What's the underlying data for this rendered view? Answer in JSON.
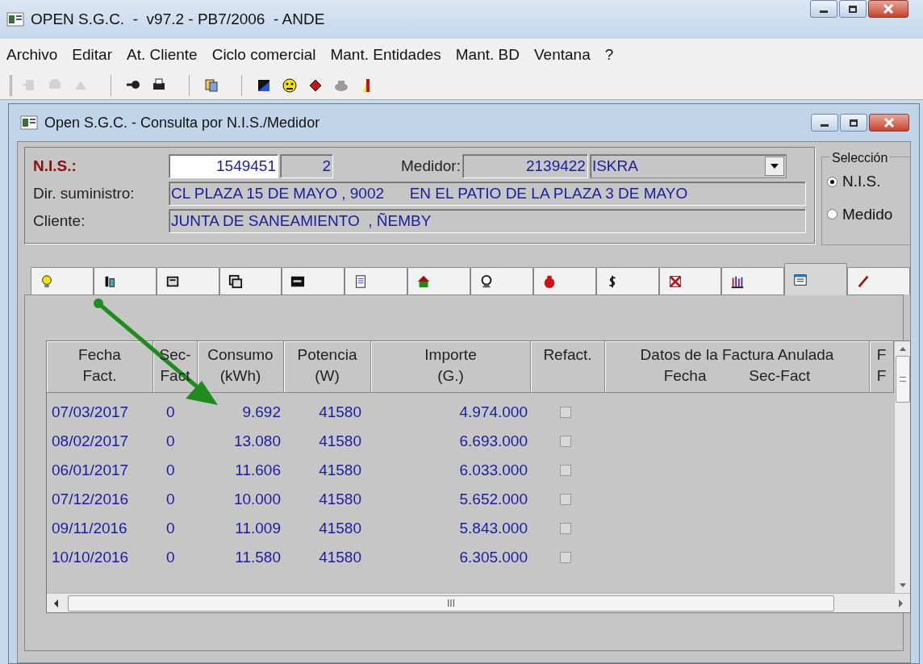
{
  "window": {
    "title": "OPEN S.G.C.  -  v97.2 - PB7/2006  - ANDE"
  },
  "menu": [
    "Archivo",
    "Editar",
    "At. Cliente",
    "Ciclo comercial",
    "Mant. Entidades",
    "Mant. BD",
    "Ventana",
    "?"
  ],
  "toolbar": [
    {
      "disabled": true
    },
    {
      "disabled": true
    },
    {
      "disabled": true
    },
    {
      "disabled": false
    },
    {
      "disabled": false
    },
    {
      "disabled": false
    },
    {
      "disabled": false
    },
    {
      "disabled": false
    },
    {
      "disabled": false
    },
    {
      "disabled": false
    },
    {
      "disabled": false
    }
  ],
  "child_window": {
    "title": "Open S.G.C. - Consulta por N.I.S./Medidor"
  },
  "form": {
    "nis_label": "N.I.S.:",
    "nis": "1549451",
    "nis_seq": "2",
    "medidor_label": "Medidor:",
    "medidor": "2139422",
    "medidor_brand": "ISKRA",
    "dir_label": "Dir. suministro:",
    "dir": "CL PLAZA 15 DE MAYO , 9002      EN EL PATIO DE LA PLAZA 3 DE MAYO",
    "cliente_label": "Cliente:",
    "cliente": "JUNTA DE SANEAMIENTO  , ÑEMBY"
  },
  "seleccion": {
    "title": "Selección",
    "options": [
      {
        "label": "N.I.S.",
        "selected": true
      },
      {
        "label": "Medido",
        "selected": false
      }
    ]
  },
  "tabs": [
    {
      "selected": false
    },
    {
      "selected": false
    },
    {
      "selected": false
    },
    {
      "selected": false
    },
    {
      "selected": false
    },
    {
      "selected": false
    },
    {
      "selected": false
    },
    {
      "selected": false
    },
    {
      "selected": false
    },
    {
      "selected": false
    },
    {
      "selected": false
    },
    {
      "selected": false
    },
    {
      "selected": true
    },
    {
      "selected": false
    }
  ],
  "table": {
    "columns": [
      [
        "Fecha",
        "Fact."
      ],
      [
        "Sec-",
        "Fact"
      ],
      [
        "Consumo",
        "(kWh)"
      ],
      [
        "Potencia",
        "(W)"
      ],
      [
        "Importe",
        "(G.)"
      ],
      [
        "Refact."
      ],
      [
        "Datos de la Factura Anulada",
        "Fecha          Sec-Fact"
      ],
      [
        "F",
        "F"
      ]
    ],
    "rows": [
      {
        "fecha": "07/03/2017",
        "sec": "0",
        "consumo": "9.692",
        "potencia": "41580",
        "importe": "4.974.000",
        "refact": false
      },
      {
        "fecha": "08/02/2017",
        "sec": "0",
        "consumo": "13.080",
        "potencia": "41580",
        "importe": "6.693.000",
        "refact": false
      },
      {
        "fecha": "06/01/2017",
        "sec": "0",
        "consumo": "11.606",
        "potencia": "41580",
        "importe": "6.033.000",
        "refact": false
      },
      {
        "fecha": "07/12/2016",
        "sec": "0",
        "consumo": "10.000",
        "potencia": "41580",
        "importe": "5.652.000",
        "refact": false
      },
      {
        "fecha": "09/11/2016",
        "sec": "0",
        "consumo": "11.009",
        "potencia": "41580",
        "importe": "5.843.000",
        "refact": false
      },
      {
        "fecha": "10/10/2016",
        "sec": "0",
        "consumo": "11.580",
        "potencia": "41580",
        "importe": "6.305.000",
        "refact": false
      }
    ],
    "hscroll_grip": "III"
  }
}
